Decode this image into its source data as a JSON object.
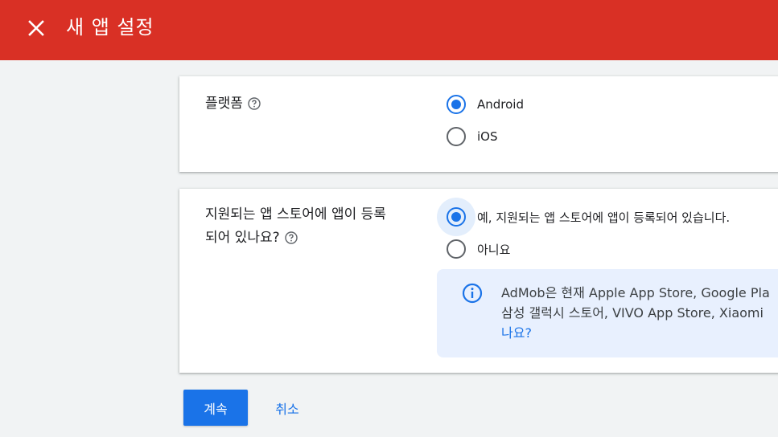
{
  "header": {
    "title": "새 앱 설정",
    "close_icon": "close-icon"
  },
  "platform": {
    "label": "플랫폼",
    "options": [
      {
        "label": "Android",
        "checked": true
      },
      {
        "label": "iOS",
        "checked": false
      }
    ]
  },
  "store": {
    "label_line1": "지원되는 앱 스토어에 앱이 등록",
    "label_line2": "되어 있나요?",
    "options": [
      {
        "label": "예, 지원되는 앱 스토어에 앱이 등록되어 있습니다.",
        "checked": true
      },
      {
        "label": "아니요",
        "checked": false
      }
    ]
  },
  "info": {
    "line1": "AdMob은 현재 Apple App Store, Google Pla",
    "line2": "삼성 갤럭시 스토어, VIVO App Store, Xiaomi",
    "line3_link": "나요?"
  },
  "actions": {
    "continue_label": "계속",
    "cancel_label": "취소"
  },
  "colors": {
    "appbar": "#d93025",
    "accent": "#1a73e8",
    "info_bg": "#e8f0fe"
  }
}
